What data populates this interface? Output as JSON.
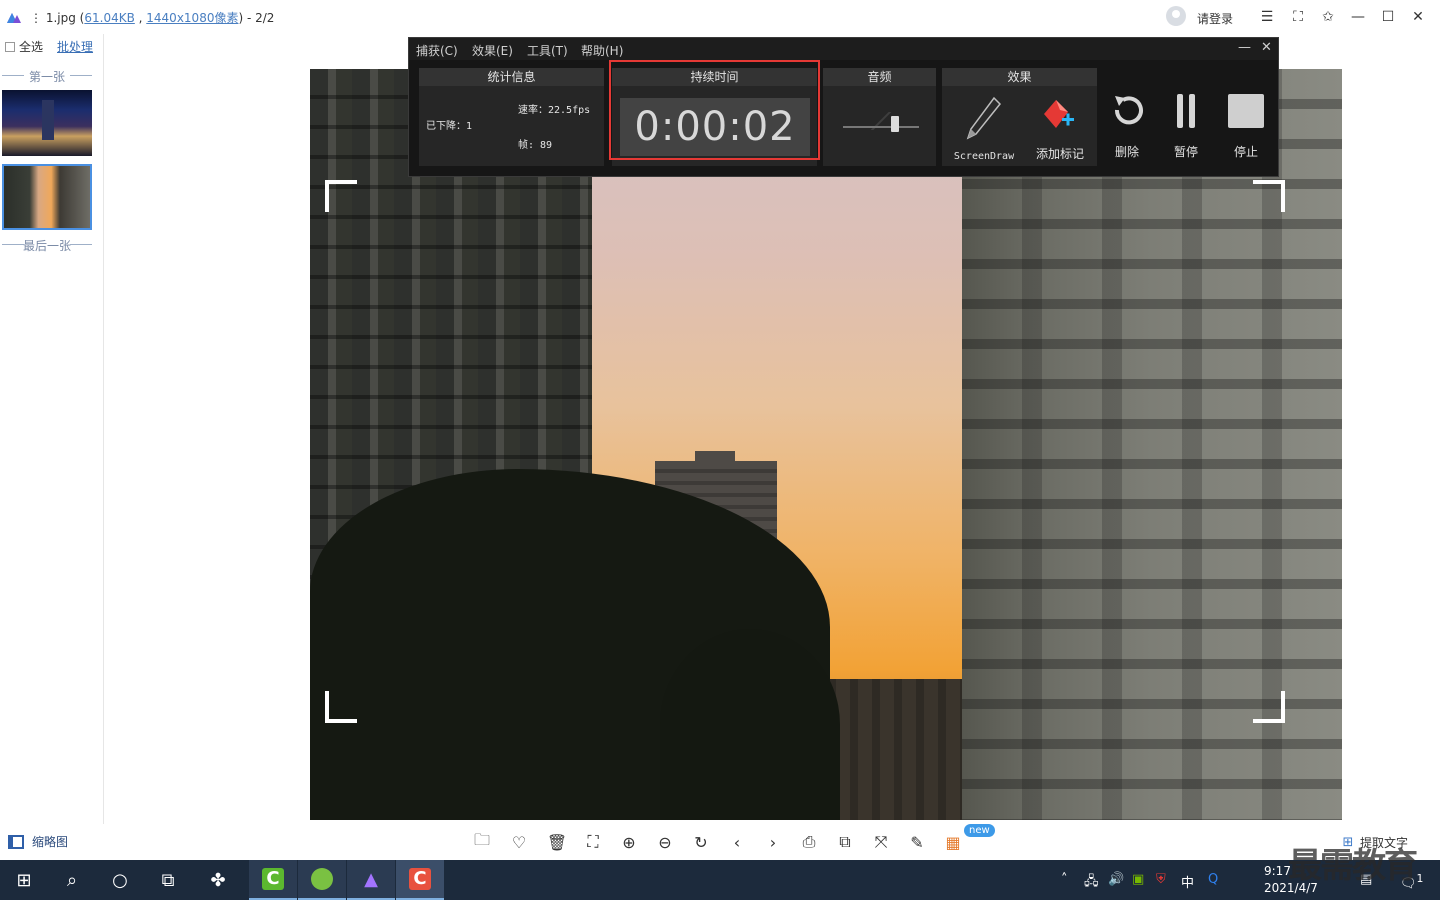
{
  "titlebar": {
    "file_name": "1.jpg",
    "file_size": "61.04KB",
    "dimensions": "1440x1080像素",
    "page_counter": "- 2/2",
    "login_label": "请登录"
  },
  "sidebar": {
    "select_all": "全选",
    "batch": "批处理",
    "first_label": "第一张",
    "last_label": "最后一张"
  },
  "recorder": {
    "menu": [
      "捕获(C)",
      "效果(E)",
      "工具(T)",
      "帮助(H)"
    ],
    "stats": {
      "title": "统计信息",
      "dropped": "已下降：1",
      "rate": "速率：22.5fps",
      "frames": "帧:  89"
    },
    "duration": {
      "title": "持续时间",
      "value": "0:00:02"
    },
    "audio": {
      "title": "音频",
      "level": 0.68
    },
    "effects": {
      "title": "效果",
      "screendraw": "ScreenDraw",
      "add_marker": "添加标记"
    },
    "buttons": {
      "delete": "删除",
      "pause": "暂停",
      "stop": "停止"
    }
  },
  "bottombar": {
    "thumbnail_label": "缩略图",
    "new_badge": "new",
    "extract_text": "提取文字"
  },
  "taskbar": {
    "time": "9:17",
    "date": "2021/4/7",
    "ime": "中",
    "notification_count": "1"
  },
  "watermark": "最需教育",
  "colors": {
    "accent": "#4a90e2",
    "highlight": "#e53935",
    "taskbar": "#1c2a3c"
  }
}
